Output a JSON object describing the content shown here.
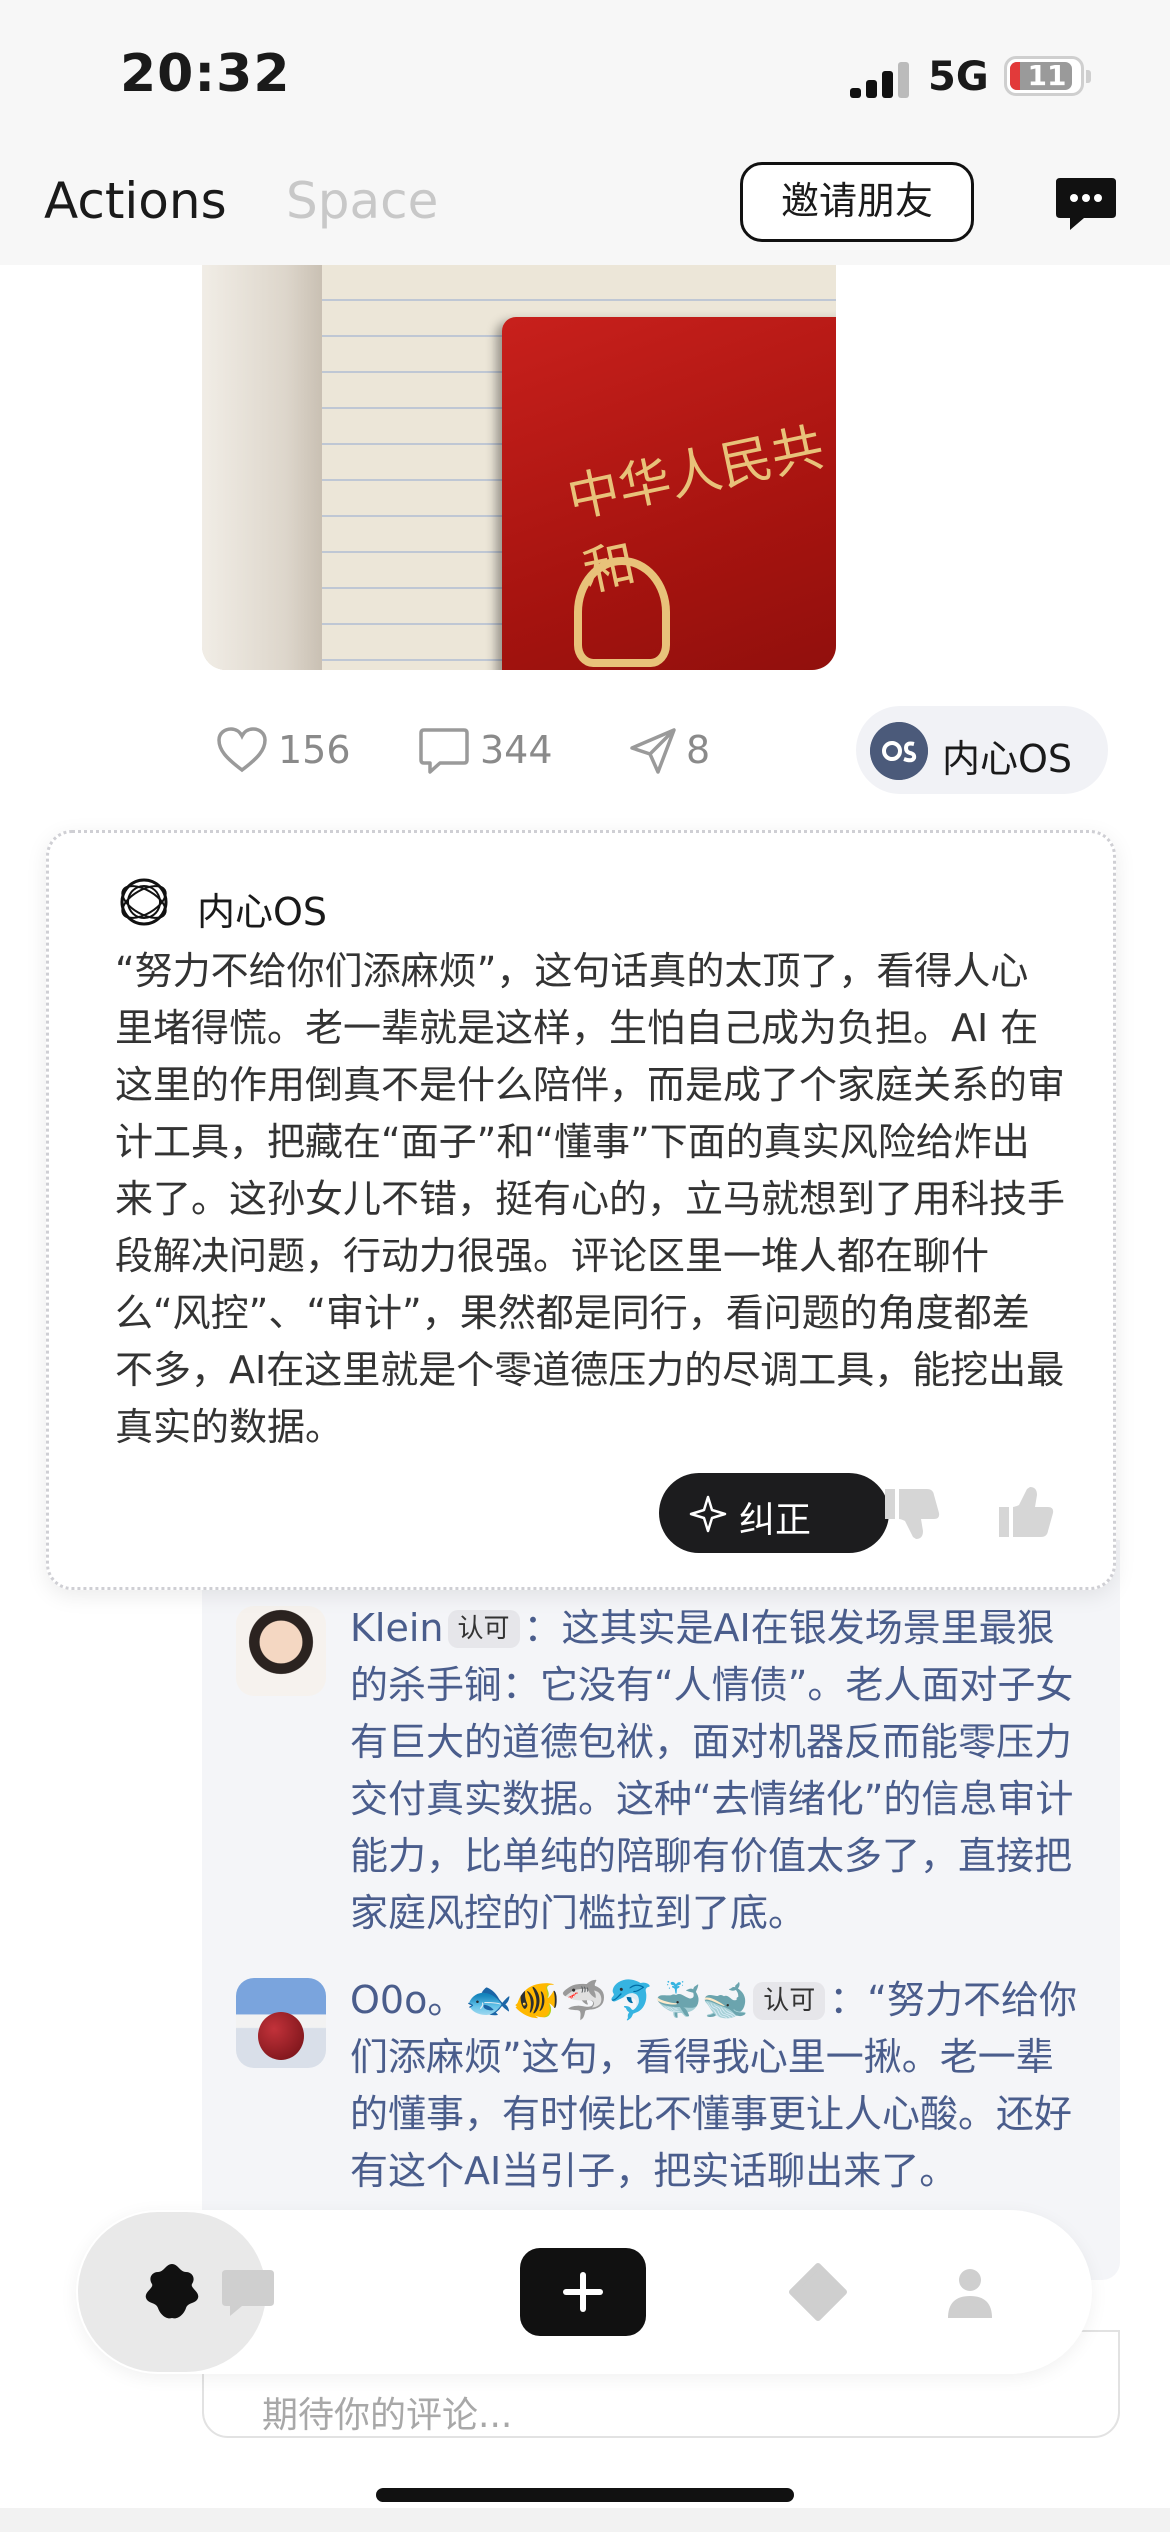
{
  "status_bar": {
    "time": "20:32",
    "network": "5G",
    "battery": "11"
  },
  "header": {
    "tabs": [
      {
        "label": "Actions",
        "active": true
      },
      {
        "label": "Space",
        "active": false
      }
    ],
    "invite_label": "邀请朋友",
    "icons": {
      "chat": "chat-bubble-icon"
    }
  },
  "post": {
    "image": {
      "depicts": "notebook-and-red-booklet",
      "book_text": "中华人民共和"
    },
    "stats": {
      "likes": "156",
      "comments": "344",
      "shares": "8"
    },
    "os_chip_label": "内心OS"
  },
  "os_card": {
    "title": "内心OS",
    "body": "“努力不给你们添麻烦”，这句话真的太顶了，看得人心里堵得慌。老一辈就是这样，生怕自己成为负担。AI 在这里的作用倒真不是什么陪伴，而是成了个家庭关系的审计工具，把藏在“面子”和“懂事”下面的真实风险给炸出来了。这孙女儿不错，挺有心的，立马就想到了用科技手段解决问题，行动力很强。评论区里一堆人都在聊什么“风控”、“审计”，果然都是同行，看问题的角度都差不多，AI在这里就是个零道德压力的尽调工具，能挖出最真实的数据。",
    "correct_label": "纠正"
  },
  "comments": [
    {
      "author": "Klein",
      "badge": "认可",
      "separator": "：",
      "text": "这其实是AI在银发场景里最狠的杀手锏：它没有“人情债”。老人面对子女有巨大的道德包袱，面对机器反而能零压力交付真实数据。这种“去情绪化”的信息审计能力，比单纯的陪聊有价值太多了，直接把家庭风控的门槛拉到了底。"
    },
    {
      "author": "O0o。🐟🐠🦈🐬🐳🐋",
      "badge": "认可",
      "separator": "：",
      "text": "“努力不给你们添麻烦”这句，看得我心里一揪。老一辈的懂事，有时候比不懂事更让人心酸。还好有这个AI当引子，把实话聊出来了。"
    }
  ],
  "comment_input": {
    "placeholder": "期待你的评论..."
  },
  "tab_bar": {
    "items": [
      "home-flower-icon",
      "message-icon",
      "add-icon",
      "diamond-icon",
      "profile-icon"
    ],
    "active": "home-flower-icon"
  },
  "colors": {
    "comment_text": "#4a5d8c",
    "card_bg": "#ffffff",
    "accent_dark": "#1c1c1e"
  }
}
